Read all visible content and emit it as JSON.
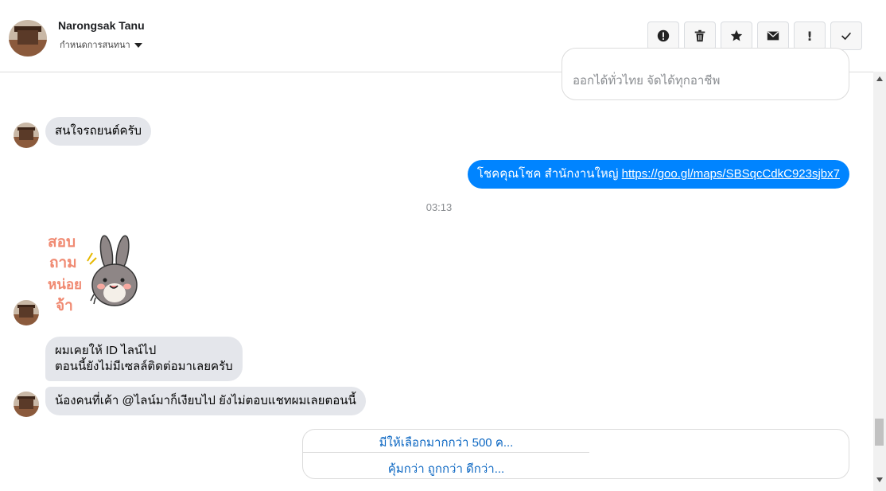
{
  "header": {
    "contact_name": "Narongsak Tanu",
    "assign_label": "กำหนดการสนทนา",
    "tools": [
      {
        "icon": "alert-circle-icon",
        "name": "spam-button"
      },
      {
        "icon": "trash-icon",
        "name": "delete-button"
      },
      {
        "icon": "star-icon",
        "name": "star-button"
      },
      {
        "icon": "envelope-icon",
        "name": "mark-unread-button"
      },
      {
        "icon": "exclamation-icon",
        "label": "!",
        "name": "important-button"
      },
      {
        "icon": "check-icon",
        "name": "done-button"
      }
    ]
  },
  "conversation": {
    "top_card_text": "ออกได้ทั่วไทย จัดได้ทุกอาชีพ",
    "msg1": "สนใจรถยนต์ครับ",
    "msg2_text": "โชคคุณโชค สำนักงานใหญ่ ",
    "msg2_link": "https://goo.gl/maps/SBSqcCdkC923sjbx7",
    "timestamp": "03:13",
    "sticker_text": [
      "สอบ",
      "ถาม",
      "หน่อย",
      "จ้า"
    ],
    "msg3_line1": "ผมเคยให้ ID ไลน์ไป",
    "msg3_line2": "ตอนนี้ยังไม่มีเซลล์ติดต่อมาเลยครับ",
    "msg4": "น้องคนที่เค้า @ไลน์มาก็เงียบไป ยังไม่ตอบแชทผมเลยตอนนี้",
    "bottom_options": [
      "มีให้เลือกมากกว่า 500 ค...",
      "คุ้มกว่า ถูกกว่า ดีกว่า..."
    ]
  },
  "colors": {
    "accent": "#0084ff",
    "incoming_bubble": "#e4e6eb",
    "link_option": "#0a66c2"
  }
}
